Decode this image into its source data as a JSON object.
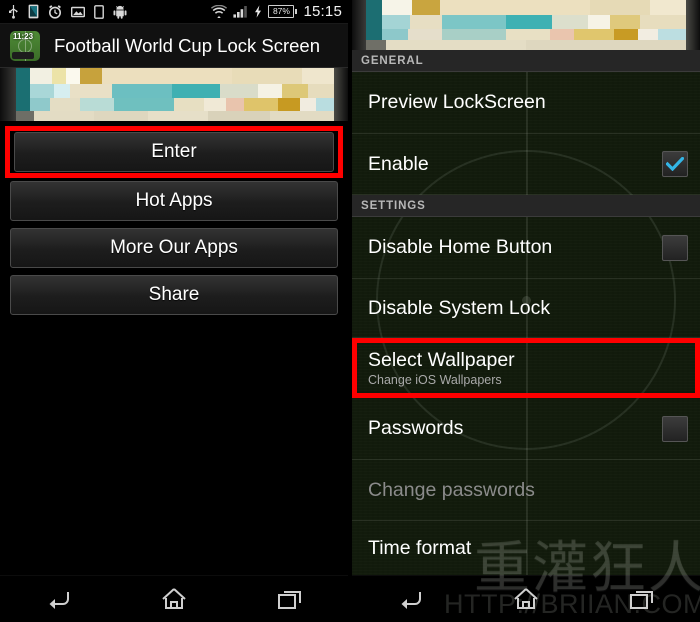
{
  "left_panel": {
    "statusbar": {
      "icons": [
        "usb-icon",
        "sd-card-icon",
        "alarm-clock-icon",
        "image-icon",
        "sim-card-icon",
        "android-robot-icon"
      ],
      "wifi_icon": "wifi-icon",
      "signal_icon": "cellular-signal-icon",
      "charging_icon": "charging-bolt-icon",
      "battery_percent": "87%",
      "clock": "15:15"
    },
    "titlebar": {
      "app_icon_name": "football-lockscreen-app-icon",
      "app_icon_time": "11:23",
      "title": "Football World Cup Lock Screen"
    },
    "banner": {
      "name": "app-banner-image"
    },
    "buttons": [
      {
        "label": "Enter",
        "highlighted": true
      },
      {
        "label": "Hot Apps",
        "highlighted": false
      },
      {
        "label": "More Our Apps",
        "highlighted": false
      },
      {
        "label": "Share",
        "highlighted": false
      }
    ],
    "navbar": {
      "back": "back-icon",
      "home": "home-icon",
      "recents": "recents-icon"
    }
  },
  "right_panel": {
    "banner": {
      "name": "settings-banner-image"
    },
    "sections": [
      {
        "header": "GENERAL",
        "rows": [
          {
            "title": "Preview LockScreen",
            "subtitle": "",
            "control": "none",
            "checked": false,
            "highlighted": false,
            "dim": false
          },
          {
            "title": "Enable",
            "subtitle": "",
            "control": "checkbox",
            "checked": true,
            "highlighted": false,
            "dim": false
          }
        ]
      },
      {
        "header": "SETTINGS",
        "rows": [
          {
            "title": "Disable Home Button",
            "subtitle": "",
            "control": "checkbox",
            "checked": false,
            "highlighted": false,
            "dim": false
          },
          {
            "title": "Disable System Lock",
            "subtitle": "",
            "control": "none",
            "checked": false,
            "highlighted": false,
            "dim": false
          },
          {
            "title": "Select Wallpaper",
            "subtitle": "Change iOS Wallpapers",
            "control": "none",
            "checked": false,
            "highlighted": true,
            "dim": false
          },
          {
            "title": "Passwords",
            "subtitle": "",
            "control": "checkbox",
            "checked": false,
            "highlighted": false,
            "dim": false
          },
          {
            "title": "Change passwords",
            "subtitle": "",
            "control": "none",
            "checked": false,
            "highlighted": false,
            "dim": true
          },
          {
            "title": "Time format",
            "subtitle": "",
            "control": "none",
            "checked": false,
            "highlighted": false,
            "dim": false
          }
        ]
      }
    ],
    "watermark": {
      "text_cjk": "重灌狂人",
      "text_url": "HTTP://BRIIAN.COM"
    },
    "navbar": {
      "back": "back-icon",
      "home": "home-icon",
      "recents": "recents-icon"
    }
  },
  "colors": {
    "highlight": "#ff0000",
    "checkbox_check": "#33b5e5",
    "section_header_bg": "#262626",
    "pitch_green": "#121b0c"
  }
}
